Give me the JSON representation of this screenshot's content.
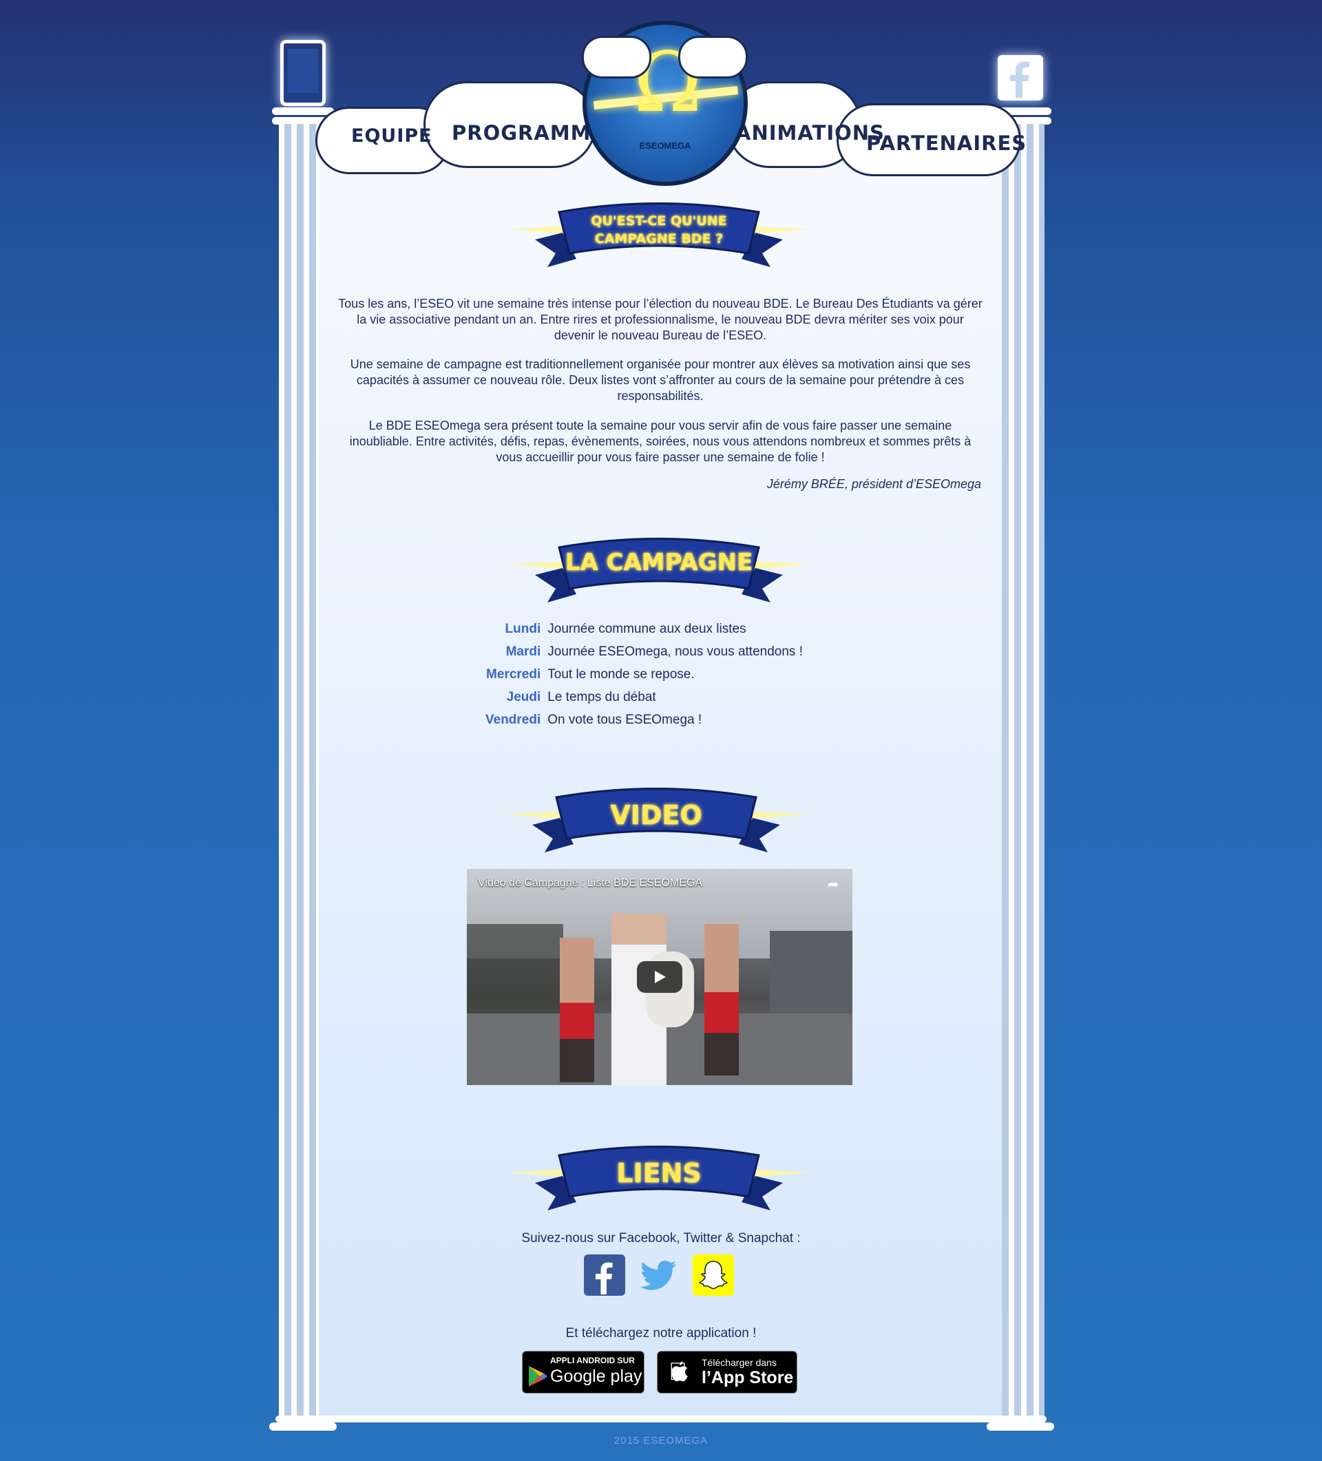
{
  "nav": {
    "equipe": "EQUIPE",
    "programme": "PROGRAMME",
    "animations": "ANIMATIONS",
    "partenaires": "PARTENAIRES",
    "logo_text": "ESEOMEGA"
  },
  "sections": {
    "campagne_bde_title_line1": "QU'EST-CE QU'UNE",
    "campagne_bde_title_line2": "CAMPAGNE BDE ?",
    "campagne_title": "LA CAMPAGNE",
    "video_title": "VIDEO",
    "liens_title": "LIENS"
  },
  "intro": {
    "p1": "Tous les ans, l’ESEO vit une semaine très intense pour l’élection du nouveau BDE. Le Bureau Des Étudiants va gérer la vie associative pendant un an. Entre rires et professionnalisme, le nouveau BDE devra mériter ses voix pour devenir le nouveau Bureau de l’ESEO.",
    "p2": "Une semaine de campagne est traditionnellement organisée pour montrer aux élèves sa motivation ainsi que ses capacités à assumer ce nouveau rôle. Deux listes vont s’affronter au cours de la semaine pour prétendre à ces responsabilités.",
    "p3": "Le BDE ESEOmega sera présent toute la semaine pour vous servir afin de vous faire passer une semaine inoubliable. Entre activités, défis, repas, évènements, soirées, nous vous attendons nombreux et sommes prêts à vous accueillir pour vous faire passer une semaine de folie !",
    "signature": "Jérémy BRÉE, président d’ESEOmega"
  },
  "schedule": [
    {
      "day": "Lundi",
      "desc": "Journée commune aux deux listes"
    },
    {
      "day": "Mardi",
      "desc": "Journée ESEOmega, nous vous attendons !"
    },
    {
      "day": "Mercredi",
      "desc": "Tout le monde se repose."
    },
    {
      "day": "Jeudi",
      "desc": "Le temps du débat"
    },
    {
      "day": "Vendredi",
      "desc": "On vote tous ESEOmega !"
    }
  ],
  "video": {
    "title": "Video de Campagne : Liste BDE ESEOMEGA"
  },
  "links": {
    "follow_text": "Suivez-nous sur Facebook, Twitter & Snapchat :",
    "download_text": "Et téléchargez notre application !",
    "google_top": "APPLI ANDROID SUR",
    "google_bottom": "Google play",
    "apple_top": "Télécharger dans",
    "apple_bottom": "l’App Store"
  },
  "footer": {
    "text": "2015 ESEOMEGA"
  },
  "colors": {
    "banner_blue": "#1f3a9e",
    "banner_text": "#ffe85a",
    "day_blue": "#3a66c4",
    "facebook": "#3b5998",
    "twitter": "#55acee",
    "snapchat": "#fffc00"
  }
}
